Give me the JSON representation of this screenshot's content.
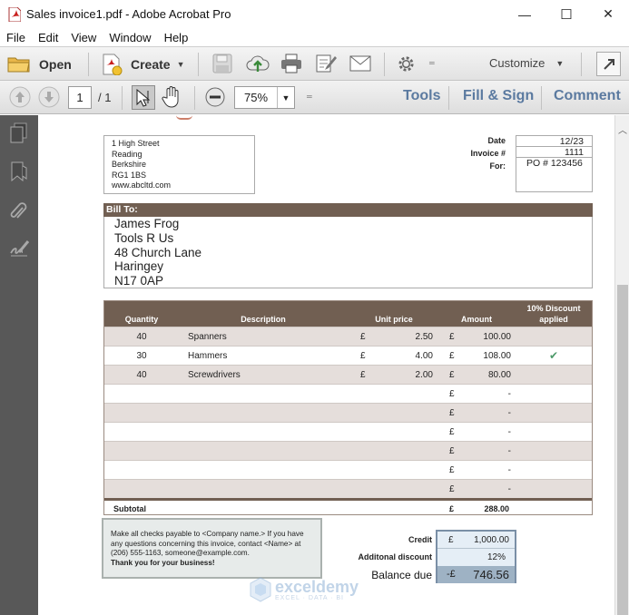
{
  "window": {
    "title": "Sales invoice1.pdf - Adobe Acrobat Pro",
    "controls": {
      "minimize": "—",
      "maximize": "☐",
      "close": "✕"
    }
  },
  "menu": [
    "File",
    "Edit",
    "View",
    "Window",
    "Help"
  ],
  "toolbar": {
    "open_label": "Open",
    "create_label": "Create",
    "customize_label": "Customize"
  },
  "nav": {
    "page_current": "1",
    "page_total": "/ 1",
    "zoom": "75%",
    "tools_label": "Tools",
    "fillsign_label": "Fill & Sign",
    "comment_label": "Comment"
  },
  "invoice": {
    "address": [
      "1 High Street",
      "Reading",
      "Berkshire",
      "RG1 1BS",
      "www.abcltd.com"
    ],
    "date_label": "Date",
    "date_value": "12/23",
    "invoice_label": "Invoice #",
    "invoice_value": "1111",
    "for_label": "For:",
    "for_value": "PO # 123456",
    "bill_to_label": "Bill To:",
    "bill_to": [
      "James Frog",
      "Tools R Us",
      "48 Church Lane",
      "Haringey",
      "N17 0AP"
    ],
    "columns": {
      "quantity": "Quantity",
      "description": "Description",
      "unit_price": "Unit price",
      "amount": "Amount",
      "discount_line1": "10% Discount",
      "discount_line2": "applied"
    },
    "rows": [
      {
        "qty": "40",
        "desc": "Spanners",
        "cur1": "£",
        "price": "2.50",
        "cur2": "£",
        "amount": "100.00",
        "discount": ""
      },
      {
        "qty": "30",
        "desc": "Hammers",
        "cur1": "£",
        "price": "4.00",
        "cur2": "£",
        "amount": "108.00",
        "discount": "✔"
      },
      {
        "qty": "40",
        "desc": "Screwdrivers",
        "cur1": "£",
        "price": "2.00",
        "cur2": "£",
        "amount": "80.00",
        "discount": ""
      },
      {
        "qty": "",
        "desc": "",
        "cur1": "",
        "price": "",
        "cur2": "£",
        "amount": "-",
        "discount": ""
      },
      {
        "qty": "",
        "desc": "",
        "cur1": "",
        "price": "",
        "cur2": "£",
        "amount": "-",
        "discount": ""
      },
      {
        "qty": "",
        "desc": "",
        "cur1": "",
        "price": "",
        "cur2": "£",
        "amount": "-",
        "discount": ""
      },
      {
        "qty": "",
        "desc": "",
        "cur1": "",
        "price": "",
        "cur2": "£",
        "amount": "-",
        "discount": ""
      },
      {
        "qty": "",
        "desc": "",
        "cur1": "",
        "price": "",
        "cur2": "£",
        "amount": "-",
        "discount": ""
      },
      {
        "qty": "",
        "desc": "",
        "cur1": "",
        "price": "",
        "cur2": "£",
        "amount": "-",
        "discount": ""
      }
    ],
    "subtotal_label": "Subtotal",
    "subtotal_cur": "£",
    "subtotal_value": "288.00",
    "note_line1": "Make all checks payable to <Company name.> If you have any questions concerning this invoice, contact <Name> at (206) 555-1163, someone@example.com.",
    "note_line2": "Thank you for your business!",
    "credit_label": "Credit",
    "credit_cur": "£",
    "credit_value": "1,000.00",
    "add_discount_label": "Additonal discount",
    "add_discount_value": "12%",
    "balance_label": "Balance due",
    "balance_cur": "-£",
    "balance_value": "746.56"
  },
  "watermark": {
    "name": "exceldemy",
    "tagline": "EXCEL · DATA · BI"
  },
  "colors": {
    "table_header": "#715f52",
    "row_alt": "#e5dedb",
    "link_blue": "#5b7aa0",
    "left_panel": "#585858",
    "checkmark": "#4e9a6a"
  }
}
